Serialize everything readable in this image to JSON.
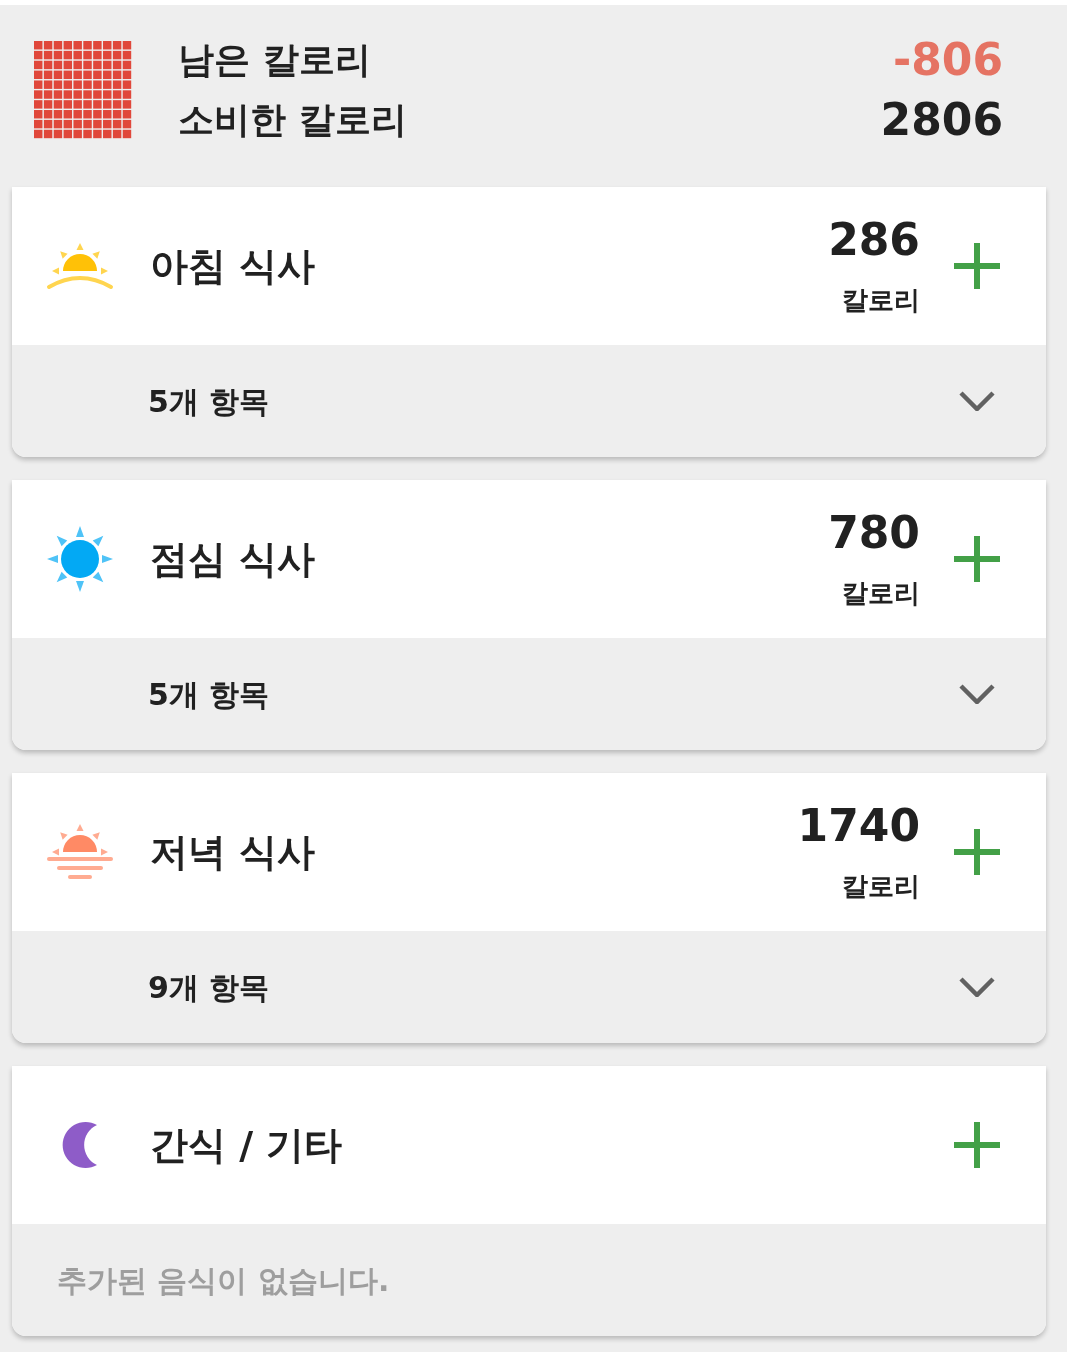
{
  "summary": {
    "remaining": {
      "label": "남은 칼로리",
      "value": "-806",
      "over_budget": true
    },
    "consumed": {
      "label": "소비한 칼로리",
      "value": "2806",
      "over_budget": false
    }
  },
  "meals": [
    {
      "kind": "breakfast",
      "title": "아침 식사",
      "calories": "286",
      "unit": "칼로리",
      "footer": {
        "kind": "count",
        "text": "5개 항목",
        "expanded": false
      }
    },
    {
      "kind": "lunch",
      "title": "점심 식사",
      "calories": "780",
      "unit": "칼로리",
      "footer": {
        "kind": "count",
        "text": "5개 항목",
        "expanded": false
      }
    },
    {
      "kind": "dinner",
      "title": "저녁 식사",
      "calories": "1740",
      "unit": "칼로리",
      "footer": {
        "kind": "count",
        "text": "9개 항목",
        "expanded": false
      }
    },
    {
      "kind": "snack",
      "title": "간식 / 기타",
      "footer": {
        "kind": "empty",
        "text": "추가된 음식이 없습니다."
      }
    }
  ]
}
